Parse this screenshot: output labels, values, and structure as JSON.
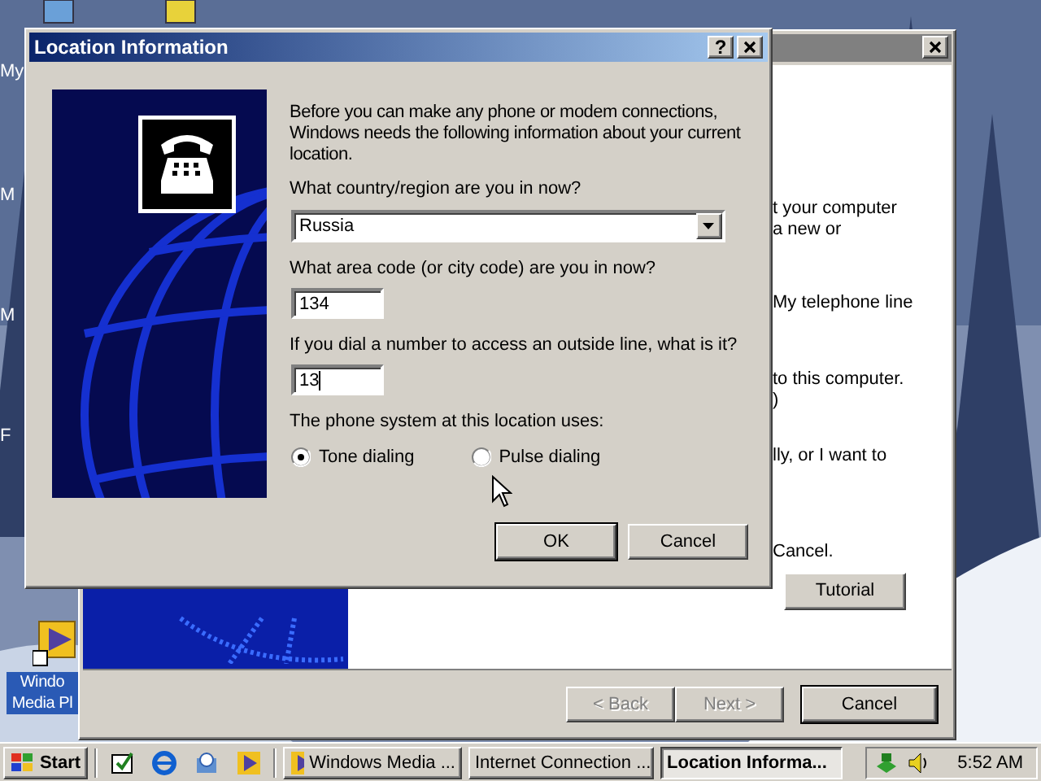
{
  "desktop": {
    "icons": [
      {
        "lines": [
          "My"
        ]
      },
      {
        "lines": [
          "M"
        ]
      },
      {
        "lines": [
          "M"
        ]
      },
      {
        "lines": [
          "F"
        ]
      },
      {
        "lines": [
          "Windo",
          "Media Pl"
        ],
        "selected": true
      }
    ]
  },
  "wizard": {
    "texts": [
      "t your computer",
      "a new or",
      "My telephone line",
      "to this computer.",
      ")",
      "lly, or I want to",
      "Cancel."
    ],
    "tutorial": "Tutorial",
    "buttons": [
      {
        "label": "< Back",
        "disabled": true
      },
      {
        "label": "Next >",
        "disabled": true
      },
      {
        "label": "Cancel",
        "disabled": false
      }
    ]
  },
  "dialog": {
    "title": "Location Information",
    "help": "?",
    "intro": "Before you can make any phone or modem connections, Windows needs the following information about your current location.",
    "country": {
      "label": "What country/region are you in now?",
      "value": "Russia"
    },
    "area_code": {
      "label": "What area code (or city code) are you in now?",
      "value": "134"
    },
    "outside_line": {
      "label": "If you dial a number to access an outside line, what is it?",
      "value": "13"
    },
    "phone_system": {
      "label": "The phone system at this location uses:",
      "options": [
        {
          "label": "Tone dialing",
          "selected": true
        },
        {
          "label": "Pulse dialing",
          "selected": false
        }
      ]
    },
    "buttons": [
      {
        "label": "OK",
        "default": true
      },
      {
        "label": "Cancel",
        "default": false
      }
    ]
  },
  "taskbar": {
    "start": "Start",
    "tasks": [
      {
        "label": "Windows Media ...",
        "selected": false
      },
      {
        "label": "Internet Connection ...",
        "selected": false
      },
      {
        "label": "Location Informa...",
        "selected": true
      }
    ],
    "clock": "5:52 AM"
  }
}
